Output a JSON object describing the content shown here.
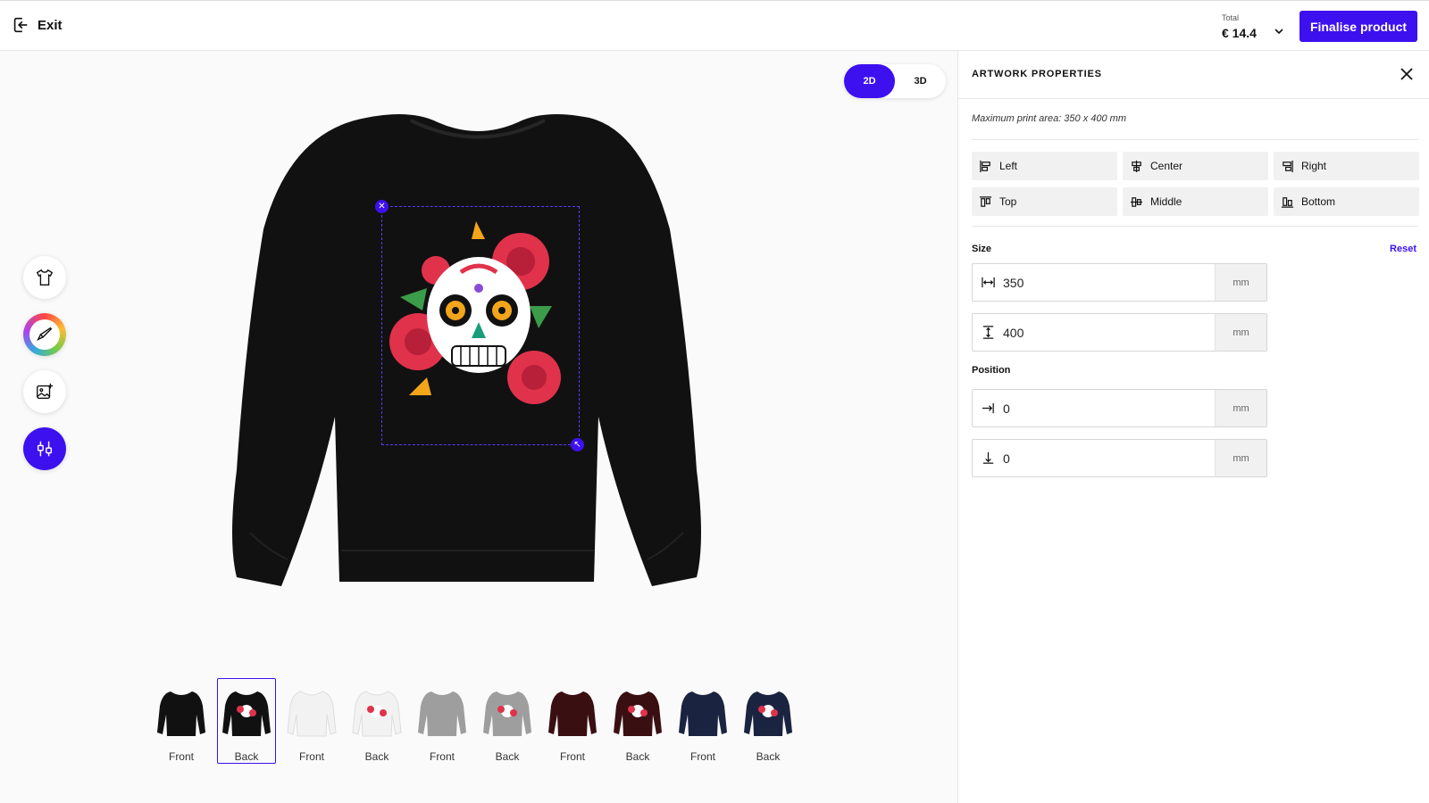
{
  "header": {
    "exit_label": "Exit",
    "total_label": "Total",
    "total_value": "€ 14.4",
    "finalise_label": "Finalise product"
  },
  "view_toggle": {
    "options": [
      "2D",
      "3D"
    ],
    "selected": "2D"
  },
  "tools": [
    {
      "icon": "tshirt-icon"
    },
    {
      "icon": "brush-icon"
    },
    {
      "icon": "image-add-icon"
    },
    {
      "icon": "adjust-icon",
      "active": true
    }
  ],
  "thumbnails": [
    {
      "label": "Front",
      "color": "#111111",
      "has_print": false
    },
    {
      "label": "Back",
      "color": "#111111",
      "has_print": true,
      "selected": true
    },
    {
      "label": "Front",
      "color": "#f2f2f2",
      "has_print": false
    },
    {
      "label": "Back",
      "color": "#f2f2f2",
      "has_print": true
    },
    {
      "label": "Front",
      "color": "#9e9e9e",
      "has_print": false
    },
    {
      "label": "Back",
      "color": "#9e9e9e",
      "has_print": true
    },
    {
      "label": "Front",
      "color": "#3a0f12",
      "has_print": false
    },
    {
      "label": "Back",
      "color": "#3a0f12",
      "has_print": true
    },
    {
      "label": "Front",
      "color": "#1a2440",
      "has_print": false
    },
    {
      "label": "Back",
      "color": "#1a2440",
      "has_print": true
    }
  ],
  "panel": {
    "title": "ARTWORK PROPERTIES",
    "max_area": "Maximum print area: 350 x 400 mm",
    "align": {
      "left": "Left",
      "center": "Center",
      "right": "Right",
      "top": "Top",
      "middle": "Middle",
      "bottom": "Bottom"
    },
    "size_label": "Size",
    "reset_label": "Reset",
    "width_value": "350",
    "height_value": "400",
    "position_label": "Position",
    "x_value": "0",
    "y_value": "0",
    "unit": "mm"
  },
  "colors": {
    "accent": "#3d10f0",
    "garment": "#111111"
  }
}
